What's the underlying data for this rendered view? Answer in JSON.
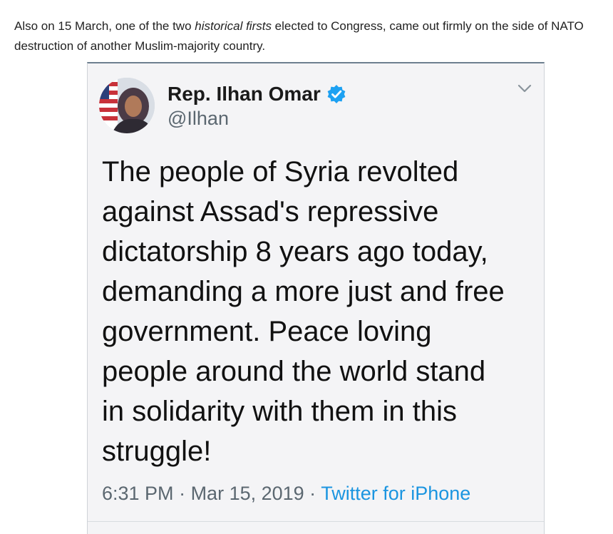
{
  "article": {
    "text_before": "Also on 15 March, one of the two ",
    "emphasis": "historical firsts",
    "text_after": " elected to Congress, came out firmly on the side of NATO destruction of another Muslim-majority country."
  },
  "tweet": {
    "display_name": "Rep. Ilhan Omar",
    "handle": "@Ilhan",
    "verified_icon": "verified-badge-icon",
    "menu_icon": "chevron-down-icon",
    "body": "The people of Syria revolted\nagainst Assad's repressive\ndictatorship 8 years ago today,\ndemanding a more just and free\ngovernment. Peace loving\npeople around the world stand\nin solidarity with them in this\nstruggle!",
    "time": "6:31 PM",
    "separator": " · ",
    "date": "Mar 15, 2019",
    "source": "Twitter for iPhone",
    "colors": {
      "link": "#1b95e0",
      "verified": "#1da1f2",
      "muted": "#5b6770"
    }
  }
}
